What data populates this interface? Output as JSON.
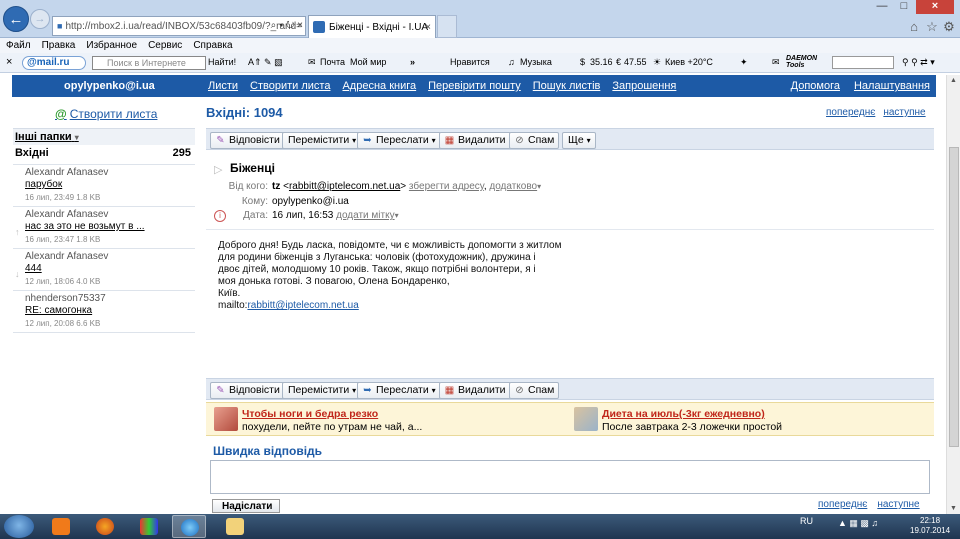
{
  "browser": {
    "url": "http://mbox2.i.ua/read/INBOX/53c68403fb09/?_rand=",
    "tab_title": "Біженці - Вхідні - I.UA",
    "menu": [
      "Файл",
      "Правка",
      "Избранное",
      "Сервис",
      "Справка"
    ],
    "toolbar": {
      "mailru": "@mail.ru",
      "search_placeholder": "Поиск в Интернете",
      "search_button": "Найти!",
      "mail": "Почта",
      "myworld": "Мой мир",
      "like": "Нравится",
      "music": "Музыка",
      "usd": "35.16",
      "eur": "47.55",
      "weather": "Киев +20°C",
      "daemon": "DAEMON Tools"
    }
  },
  "header": {
    "user": "opylypenko@i.ua",
    "nav": [
      "Листи",
      "Створити листа",
      "Адресна книга",
      "Перевірити пошту",
      "Пошук листів",
      "Запрошення"
    ],
    "right_nav": [
      "Допомога",
      "Налаштування"
    ]
  },
  "sidebar": {
    "compose": "Створити листа",
    "other_folders": "Інші папки",
    "inbox_label": "Вхідні",
    "inbox_count": "295",
    "messages": [
      {
        "from": "Alexandr Afanasev",
        "subject": "парубок",
        "meta": "16 лип, 23:49 1.8 KB"
      },
      {
        "from": "Alexandr Afanasev",
        "subject": "нас за это не возьмут в ...",
        "meta": "16 лип, 23:47 1.8 KB"
      },
      {
        "from": "Alexandr Afanasev",
        "subject": "444",
        "meta": "12 лип, 18:06 4.0 KB"
      },
      {
        "from": "nhenderson75337",
        "subject": "RE: самогонка",
        "meta": "12 лип, 20:08 6.6 KB"
      }
    ]
  },
  "main": {
    "folder_title": "Вхідні: 1094",
    "pager": {
      "prev": "попереднє",
      "next": "наступне"
    },
    "toolbar": {
      "reply": "Відповісти",
      "move": "Перемістити",
      "forward": "Переслати",
      "delete": "Видалити",
      "spam": "Спам",
      "more": "Ще"
    },
    "message": {
      "subject": "Біженці",
      "from_label": "Від кого:",
      "from_name": "tz",
      "from_email": "rabbitt@iptelecom.net.ua",
      "save_address": "зберегти адресу",
      "additionally": "додатково",
      "to_label": "Кому:",
      "to": "opylypenko@i.ua",
      "date_label": "Дата:",
      "date": "16 лип, 16:53",
      "add_tag": "додати мітку",
      "body_lines": [
        "Доброго дня! Будь ласка, повідомте, чи є можливість допомогти з житлом",
        "для родини біженців з Луганська: чоловік (фотохудожник), дружина і",
        "двоє дітей, молодшому 10 років. Також, якщо потрібні волонтери, я і",
        "моя донька готові. З повагою, Олена Бондаренко,"
      ],
      "city": "Київ.",
      "mailto_prefix": "mailto:",
      "mailto": "rabbitt@iptelecom.net.ua"
    },
    "ads": [
      {
        "title": "Чтобы ноги и бедра резко",
        "desc": "похудели, пейте по утрам не чай, а..."
      },
      {
        "title": "Диета на июль(-3кг ежедневно)",
        "desc": "После завтрака 2-3 ложечки простой"
      }
    ],
    "quick_reply": "Швидка відповідь",
    "send": "Надіслати"
  },
  "taskbar": {
    "lang": "RU",
    "time": "22:18",
    "date": "19.07.2014"
  },
  "colors": {
    "brand": "#1d5aa6",
    "ad_title": "#c0261a"
  }
}
